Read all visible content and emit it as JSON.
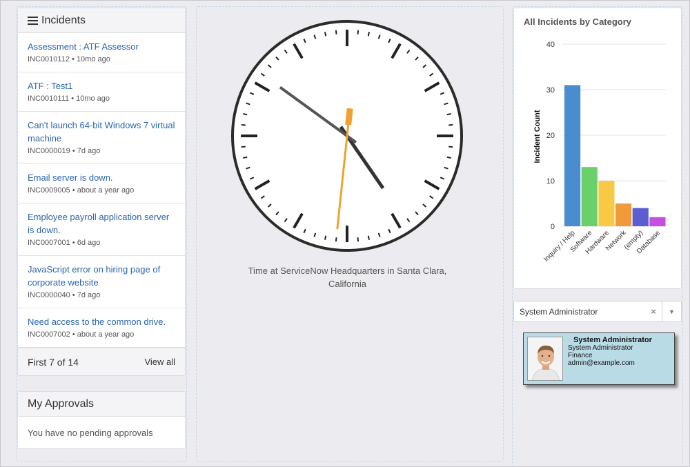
{
  "incidents": {
    "title": "Incidents",
    "items": [
      {
        "title": "Assessment : ATF Assessor",
        "meta": "INC0010112 • 10mo ago"
      },
      {
        "title": "ATF : Test1",
        "meta": "INC0010111 • 10mo ago"
      },
      {
        "title": "Can't launch 64-bit Windows 7 virtual machine",
        "meta": "INC0000019 • 7d ago"
      },
      {
        "title": "Email server is down.",
        "meta": "INC0009005 • about a year ago"
      },
      {
        "title": "Employee payroll application server is down.",
        "meta": "INC0007001 • 6d ago"
      },
      {
        "title": "JavaScript error on hiring page of corporate website",
        "meta": "INC0000040 • 7d ago"
      },
      {
        "title": "Need access to the common drive.",
        "meta": "INC0007002 • about a year ago"
      }
    ],
    "footer_count": "First 7 of 14",
    "view_all": "View all"
  },
  "approvals": {
    "title": "My Approvals",
    "empty_text": "You have no pending approvals"
  },
  "clock": {
    "caption": "Time at ServiceNow Headquarters in Santa Clara, California",
    "hour": 4,
    "minute": 51,
    "second": 31,
    "color_second_hand": "#f0a22e"
  },
  "chart_data": {
    "type": "bar",
    "title": "All Incidents by Category",
    "ylabel": "Incident Count",
    "xlabel": "",
    "ylim": [
      0,
      40
    ],
    "yticks": [
      0,
      10,
      20,
      30,
      40
    ],
    "grid": true,
    "categories": [
      "Inquiry / Help",
      "Software",
      "Hardware",
      "Network",
      "(empty)",
      "Database"
    ],
    "values": [
      31,
      13,
      10,
      5,
      4,
      2
    ],
    "colors": [
      "#4a8dce",
      "#6ad06a",
      "#f7c944",
      "#f09a3a",
      "#5a5ed0",
      "#c44fe0"
    ]
  },
  "user_select": {
    "value": "System Administrator",
    "clear": "×",
    "caret": "▼"
  },
  "user_card": {
    "name": "System Administrator",
    "title": "System Administrator",
    "department": "Finance",
    "email": "admin@example.com"
  }
}
